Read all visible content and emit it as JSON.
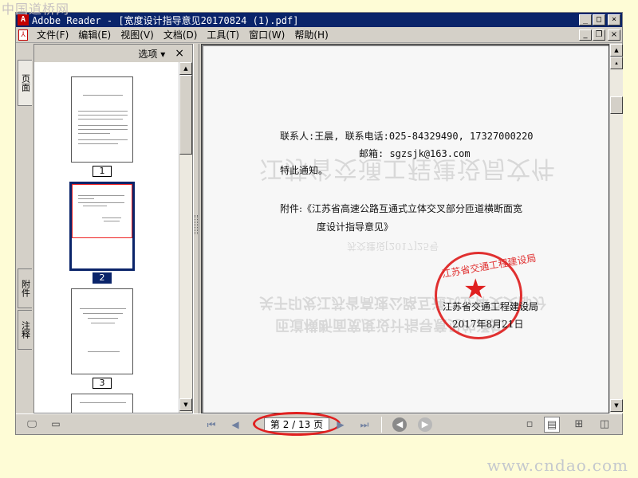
{
  "watermarks": {
    "top_left": "中国道桥网",
    "bottom_right": "www.cndao.com"
  },
  "titlebar": {
    "title": "Adobe Reader - [宽度设计指导意见20170824 (1).pdf]"
  },
  "menu": {
    "items": [
      "文件(F)",
      "编辑(E)",
      "视图(V)",
      "文档(D)",
      "工具(T)",
      "窗口(W)",
      "帮助(H)"
    ]
  },
  "side_tabs": {
    "pages": "页面",
    "attachments": "附件",
    "comments": "注释"
  },
  "panel": {
    "options_label": "选项 ▾",
    "close": "×"
  },
  "thumbnails": [
    {
      "label": "1",
      "selected": false
    },
    {
      "label": "2",
      "selected": true
    },
    {
      "label": "3",
      "selected": false
    }
  ],
  "document": {
    "contact": "联系人:王晨,  联系电话:025-84329490,  17327000220",
    "email": "邮箱: sgzsjk@163.com",
    "notice": "特此通知。",
    "attachment_line1": "附件:《江苏省高速公路互通式立体交叉部分匝道横断面宽",
    "attachment_line2": "度设计指导意见》",
    "issuer": "江苏省交通工程建设局",
    "date": "2017年8月21日",
    "stamp_text": "江苏省交通工程建设局",
    "ghost_heading": "江苏省交通工程建设局文件",
    "ghost_line1": "关于印发江苏省高速公路互通式立体交叉部分",
    "ghost_line2": "匝道横断面宽度设计指导意见的通知",
    "ghost_small": "苏交建设[2017]25号"
  },
  "statusbar": {
    "page_indicator": "第 2 / 13 页",
    "current_page": 2,
    "total_pages": 13
  },
  "colors": {
    "title_bar": "#0a246a",
    "highlight_circle": "#e02020",
    "stamp": "#e03030"
  }
}
